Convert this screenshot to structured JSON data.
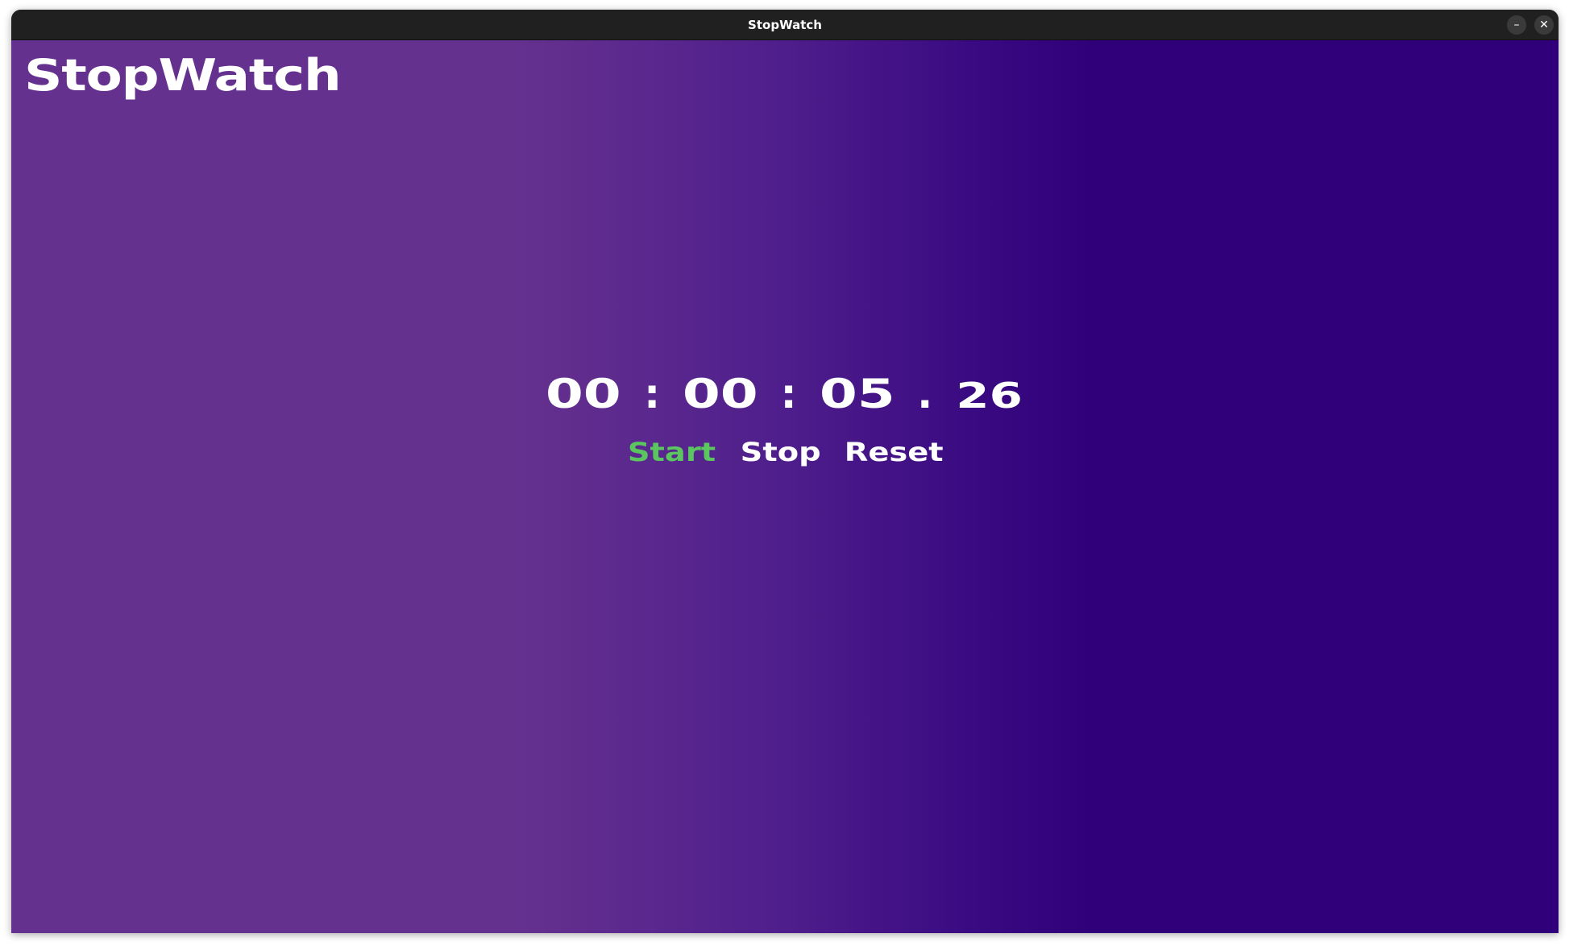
{
  "window": {
    "title": "StopWatch",
    "minimize_glyph": "–",
    "close_glyph": "✕"
  },
  "app": {
    "title": "StopWatch"
  },
  "timer": {
    "hours": "00",
    "minutes": "00",
    "seconds": "05",
    "centiseconds": "26",
    "sep_colon": ":",
    "sep_dot": "."
  },
  "controls": {
    "start_label": "Start",
    "stop_label": "Stop",
    "reset_label": "Reset"
  },
  "colors": {
    "gradient_left": "#65318f",
    "gradient_right": "#2f0079",
    "start_active": "#5bc560",
    "text": "#ffffff",
    "titlebar": "#202020"
  },
  "icons": {
    "minimize": "minimize-icon",
    "close": "close-icon"
  }
}
